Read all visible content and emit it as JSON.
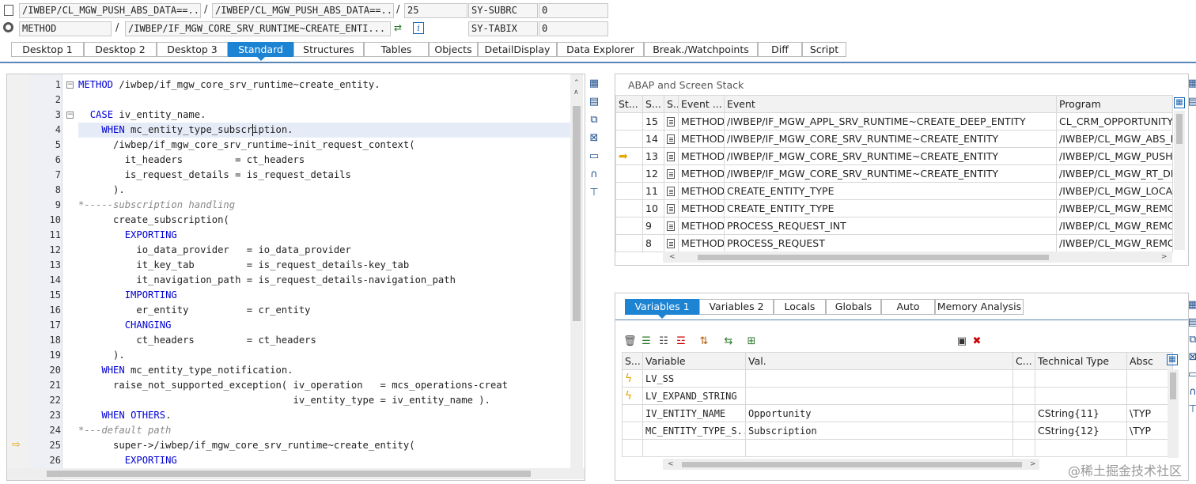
{
  "toolbar": {
    "row1": {
      "field1": "/IWBEP/CL_MGW_PUSH_ABS_DATA==...",
      "field2": "/IWBEP/CL_MGW_PUSH_ABS_DATA==...",
      "field3": "25",
      "sy1_label": "SY-SUBRC",
      "sy1_value": "0"
    },
    "row2": {
      "type": "METHOD",
      "name": "/IWBEP/IF_MGW_CORE_SRV_RUNTIME~CREATE_ENTI...",
      "sy2_label": "SY-TABIX",
      "sy2_value": "0"
    },
    "slash": "/"
  },
  "tabs": [
    "Desktop 1",
    "Desktop 2",
    "Desktop 3",
    "Standard",
    "Structures",
    "Tables",
    "Objects",
    "DetailDisplay",
    "Data Explorer",
    "Break./Watchpoints",
    "Diff",
    "Script"
  ],
  "editor": {
    "line_numbers": [
      "1",
      "2",
      "3",
      "4",
      "5",
      "6",
      "7",
      "8",
      "9",
      "10",
      "11",
      "12",
      "13",
      "14",
      "15",
      "16",
      "17",
      "18",
      "19",
      "20",
      "21",
      "22",
      "23",
      "24",
      "25",
      "26"
    ],
    "lines": [
      "METHOD /iwbep/if_mgw_core_srv_runtime~create_entity.",
      "",
      "  CASE iv_entity_name.",
      "    WHEN mc_entity_type_subscription.",
      "      /iwbep/if_mgw_core_srv_runtime~init_request_context(",
      "        it_headers         = ct_headers",
      "        is_request_details = is_request_details",
      "      ).",
      "*-----subscription handling",
      "      create_subscription(",
      "        EXPORTING",
      "          io_data_provider   = io_data_provider",
      "          it_key_tab         = is_request_details-key_tab",
      "          it_navigation_path = is_request_details-navigation_path",
      "        IMPORTING",
      "          er_entity          = cr_entity",
      "        CHANGING",
      "          ct_headers         = ct_headers",
      "      ).",
      "    WHEN mc_entity_type_notification.",
      "      raise_not_supported_exception( iv_operation   = mcs_operations-creat",
      "                                     iv_entity_type = iv_entity_name ).",
      "    WHEN OTHERS.",
      "*---default path",
      "      super->/iwbep/if_mgw_core_srv_runtime~create_entity(",
      "        EXPORTING"
    ]
  },
  "stack": {
    "title": "ABAP and Screen Stack",
    "headers": [
      "St...",
      "S...",
      "S...",
      "Event ...",
      "Event",
      "Program"
    ],
    "rows": [
      {
        "level": "15",
        "type": "METHOD",
        "event": "/IWBEP/IF_MGW_APPL_SRV_RUNTIME~CREATE_DEEP_ENTITY",
        "program": "CL_CRM_OPPORTUNITY_"
      },
      {
        "level": "14",
        "type": "METHOD",
        "event": "/IWBEP/IF_MGW_CORE_SRV_RUNTIME~CREATE_ENTITY",
        "program": "/IWBEP/CL_MGW_ABS_D"
      },
      {
        "level": "13",
        "type": "METHOD",
        "event": "/IWBEP/IF_MGW_CORE_SRV_RUNTIME~CREATE_ENTITY",
        "program": "/IWBEP/CL_MGW_PUSH_"
      },
      {
        "level": "12",
        "type": "METHOD",
        "event": "/IWBEP/IF_MGW_CORE_SRV_RUNTIME~CREATE_ENTITY",
        "program": "/IWBEP/CL_MGW_RT_DE"
      },
      {
        "level": "11",
        "type": "METHOD",
        "event": "CREATE_ENTITY_TYPE",
        "program": "/IWBEP/CL_MGW_LOCAL"
      },
      {
        "level": "10",
        "type": "METHOD",
        "event": "CREATE_ENTITY_TYPE",
        "program": "/IWBEP/CL_MGW_REMO"
      },
      {
        "level": "9",
        "type": "METHOD",
        "event": "PROCESS_REQUEST_INT",
        "program": "/IWBEP/CL_MGW_REMO"
      },
      {
        "level": "8",
        "type": "METHOD",
        "event": "PROCESS_REQUEST",
        "program": "/IWBEP/CL_MGW_REMO"
      }
    ]
  },
  "vars": {
    "tabs": [
      "Variables 1",
      "Variables 2",
      "Locals",
      "Globals",
      "Auto",
      "Memory Analysis"
    ],
    "headers": [
      "S...",
      "Variable",
      "Val.",
      "C...",
      "Technical Type",
      "Absc"
    ],
    "rows": [
      {
        "variable": "LV_SS",
        "value": "",
        "type": "",
        "abs": ""
      },
      {
        "variable": "LV_EXPAND_STRING",
        "value": "",
        "type": "",
        "abs": ""
      },
      {
        "variable": "IV_ENTITY_NAME",
        "value": "Opportunity",
        "type": "CString{11}",
        "abs": "\\TYP"
      },
      {
        "variable": "MC_ENTITY_TYPE_S...",
        "value": "Subscription",
        "type": "CString{12}",
        "abs": "\\TYP"
      },
      {
        "variable": "",
        "value": "",
        "type": "",
        "abs": ""
      }
    ]
  },
  "watermark": "@稀土掘金技术社区",
  "colors": {
    "accent": "#1d84d4",
    "keyword": "#0000d4",
    "comment": "#888888",
    "marker": "#f0b400"
  }
}
